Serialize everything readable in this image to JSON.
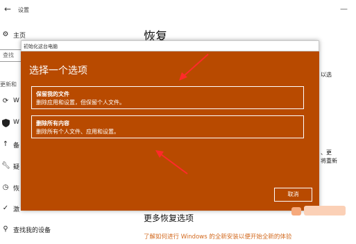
{
  "window": {
    "title": "设置",
    "minimize_glyph": "—"
  },
  "sidebar": {
    "home_label": "主页",
    "search_placeholder": "查找",
    "section_label": "更新和",
    "items": [
      {
        "icon": "sync-icon",
        "label": "W"
      },
      {
        "icon": "shield-icon",
        "label": "W"
      },
      {
        "icon": "upload-icon",
        "label": "备"
      },
      {
        "icon": "wrench-icon",
        "label": "疑"
      },
      {
        "icon": "history-icon",
        "label": "恢"
      },
      {
        "icon": "check-circle-icon",
        "label": "激"
      },
      {
        "icon": "person-pin-icon",
        "label": "查找我的设备"
      }
    ]
  },
  "main": {
    "title": "恢复",
    "fragments": [
      "以选",
      "、更",
      "将重新"
    ],
    "more_title": "更多恢复选项",
    "more_link": "了解如何进行 Windows 的全新安装以便开始全新的体验"
  },
  "dialog": {
    "header": "初始化这台电脑",
    "heading": "选择一个选项",
    "options": [
      {
        "title": "保留我的文件",
        "desc": "删除应用和设置，但保留个人文件。"
      },
      {
        "title": "删除所有内容",
        "desc": "删除所有个人文件、应用和设置。"
      }
    ],
    "cancel_label": "取消"
  },
  "colors": {
    "dialog_bg": "#b84a00",
    "annotation_arrow": "#ff2a2a",
    "link": "#d2691e"
  }
}
